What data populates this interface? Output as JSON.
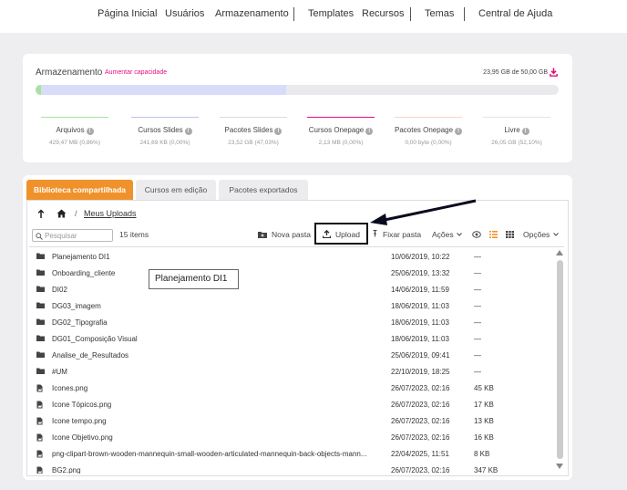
{
  "nav": {
    "items": [
      "Página Inicial",
      "Usuários",
      "Armazenamento",
      "Templates",
      "Recursos",
      "Temas",
      "Central de Ajuda"
    ]
  },
  "storage": {
    "title": "Armazenamento",
    "increase_link": "Aumentar capacidade",
    "total": "23,95 GB de 50,00 GB",
    "used_fraction": 0.479,
    "categories": [
      {
        "label": "Arquivos",
        "value": "429,47 MB (0,86%)",
        "color": "#a8e2a0"
      },
      {
        "label": "Cursos Slides",
        "value": "241,69 KB (0,00%)",
        "color": "#b9c5e8"
      },
      {
        "label": "Pacotes Slides",
        "value": "23,52 GB (47,03%)",
        "color": "#dcdcdc"
      },
      {
        "label": "Cursos Onepage",
        "value": "2,13 MB (0,00%)",
        "color": "#e2107e"
      },
      {
        "label": "Pacotes Onepage",
        "value": "0,00 byte (0,00%)",
        "color": "#f6d7c4"
      },
      {
        "label": "Livre",
        "value": "26,05 GB (52,10%)",
        "color": "#e4e4e4"
      }
    ]
  },
  "library": {
    "tabs": [
      "Biblioteca compartilhada",
      "Cursos em edição",
      "Pacotes exportados"
    ],
    "breadcrumb": {
      "current": "Meus Uploads"
    },
    "search": {
      "placeholder": "Pesquisar",
      "value": ""
    },
    "items_count": "15 items",
    "toolbar": {
      "new_folder": "Nova pasta",
      "upload": "Upload",
      "pin_folder": "Fixar pasta",
      "actions": "Ações",
      "options": "Opções"
    },
    "rows": [
      {
        "type": "folder",
        "name": "Planejamento DI1",
        "date": "10/06/2019, 10:22",
        "size": "—"
      },
      {
        "type": "folder",
        "name": "Onboarding_cliente",
        "date": "25/06/2019, 13:32",
        "size": "—"
      },
      {
        "type": "folder",
        "name": "DI02",
        "date": "14/06/2019, 11:59",
        "size": "—"
      },
      {
        "type": "folder",
        "name": "DG03_imagem",
        "date": "18/06/2019, 11:03",
        "size": "—"
      },
      {
        "type": "folder",
        "name": "DG02_Tipografia",
        "date": "18/06/2019, 11:03",
        "size": "—"
      },
      {
        "type": "folder",
        "name": "DG01_Composição Visual",
        "date": "18/06/2019, 11:03",
        "size": "—"
      },
      {
        "type": "folder",
        "name": "Analise_de_Resultados",
        "date": "25/06/2019, 09:41",
        "size": "—"
      },
      {
        "type": "folder",
        "name": "#UM",
        "date": "22/10/2019, 18:25",
        "size": "—"
      },
      {
        "type": "file",
        "name": "Icones.png",
        "date": "26/07/2023, 02:16",
        "size": "45 KB"
      },
      {
        "type": "file",
        "name": "Icone Tópicos.png",
        "date": "26/07/2023, 02:16",
        "size": "17 KB"
      },
      {
        "type": "file",
        "name": "Icone tempo.png",
        "date": "26/07/2023, 02:16",
        "size": "13 KB"
      },
      {
        "type": "file",
        "name": "Icone Objetivo.png",
        "date": "26/07/2023, 02:16",
        "size": "16 KB"
      },
      {
        "type": "file",
        "name": "png-clipart-brown-wooden-mannequin-small-wooden-articulated-mannequin-back-objects-mann...",
        "date": "22/04/2025, 11:51",
        "size": "8 KB"
      },
      {
        "type": "file",
        "name": "BG2.png",
        "date": "26/07/2023, 02:16",
        "size": "347 KB"
      }
    ],
    "tooltip": "Planejamento DI1"
  },
  "colors": {
    "accent": "#f0922b",
    "brand": "#e2107e"
  }
}
